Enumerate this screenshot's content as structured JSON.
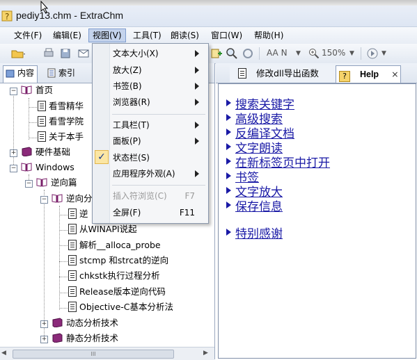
{
  "window": {
    "title": "pediy13.chm - ExtraChm"
  },
  "menubar": [
    {
      "label": "文件(F)"
    },
    {
      "label": "编辑(E)"
    },
    {
      "label": "视图(V)"
    },
    {
      "label": "工具(T)"
    },
    {
      "label": "朗读(S)"
    },
    {
      "label": "窗口(W)"
    },
    {
      "label": "帮助(H)"
    }
  ],
  "toolbar": {
    "font_label": "AA  N",
    "zoom": "150%"
  },
  "left_tabs": {
    "contents": "内容",
    "index": "索引"
  },
  "tree": [
    {
      "label": "首页"
    },
    {
      "label": "看雪精华"
    },
    {
      "label": "看雪学院"
    },
    {
      "label": "关于本手"
    },
    {
      "label": "硬件基础"
    },
    {
      "label": "Windows"
    },
    {
      "label": "逆向篇"
    },
    {
      "label": "逆向分"
    },
    {
      "label": "逆"
    },
    {
      "label": "从WINAPI说起"
    },
    {
      "label": "解析__alloca_probe"
    },
    {
      "label": "stcmp 和strcat的逆向"
    },
    {
      "label": "chkstk执行过程分析"
    },
    {
      "label": "Release版本逆向代码"
    },
    {
      "label": "Objective-C基本分析法"
    },
    {
      "label": "动态分析技术"
    },
    {
      "label": "静态分析技术"
    }
  ],
  "scrollbar": {
    "thumb": "III"
  },
  "right_tabs": {
    "doc": "修改dll导出函数",
    "help": "Help",
    "close": "×"
  },
  "content_links": [
    {
      "label": "搜索关键字"
    },
    {
      "label": "高级搜索"
    },
    {
      "label": "反编译文档"
    },
    {
      "label": "文字朗读"
    },
    {
      "label": "在新标签页中打开"
    },
    {
      "label": "书签"
    },
    {
      "label": "文字放大"
    },
    {
      "label": "保存信息"
    },
    {
      "label": "特别感谢"
    }
  ],
  "view_menu": {
    "items": [
      {
        "label": "文本大小(X)"
      },
      {
        "label": "放大(Z)"
      },
      {
        "label": "书签(B)"
      },
      {
        "label": "浏览器(R)"
      },
      {
        "label": "工具栏(T)"
      },
      {
        "label": "面板(P)"
      },
      {
        "label": "状态栏(S)",
        "checked": true
      },
      {
        "label": "应用程序外观(A)"
      },
      {
        "label": "插入符浏览(C)",
        "shortcut": "F7",
        "disabled": true
      },
      {
        "label": "全屏(F)",
        "shortcut": "F11"
      }
    ]
  },
  "colors": {
    "link": "#1a1aa6",
    "menu_highlight": "#c4d3ec",
    "check_bg": "#fbe6a4"
  }
}
